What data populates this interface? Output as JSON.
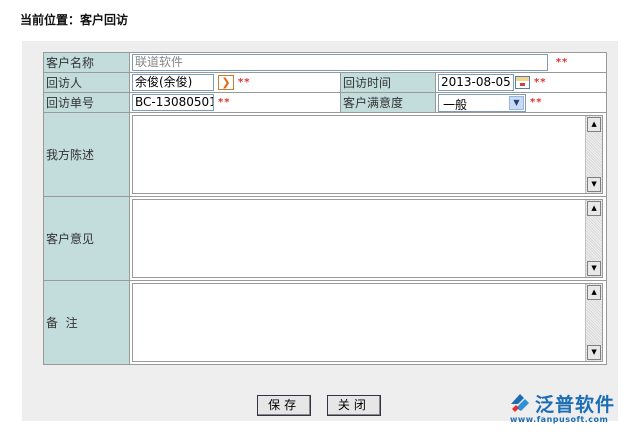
{
  "breadcrumb": "当前位置：客户回访",
  "form": {
    "customer_name": {
      "label": "客户名称",
      "value": "联道软件"
    },
    "visitor": {
      "label": "回访人",
      "value": "余俊(余俊)"
    },
    "visit_time": {
      "label": "回访时间",
      "value": "2013-08-05"
    },
    "visit_no": {
      "label": "回访单号",
      "value": "BC-13080501"
    },
    "satisfaction": {
      "label": "客户满意度",
      "value": "一般"
    },
    "our_statement": {
      "label": "我方陈述",
      "value": ""
    },
    "customer_opinion": {
      "label": "客户意见",
      "value": ""
    },
    "remarks": {
      "label": "备  注",
      "value": ""
    },
    "required_mark": "**"
  },
  "buttons": {
    "save": "保存",
    "close": "关闭"
  },
  "logo": {
    "name": "泛普软件",
    "url": "www.fanpusoft.com"
  },
  "colors": {
    "label_bg": "#c3dcdc",
    "required": "#e0312d",
    "brand": "#1d6db5"
  }
}
